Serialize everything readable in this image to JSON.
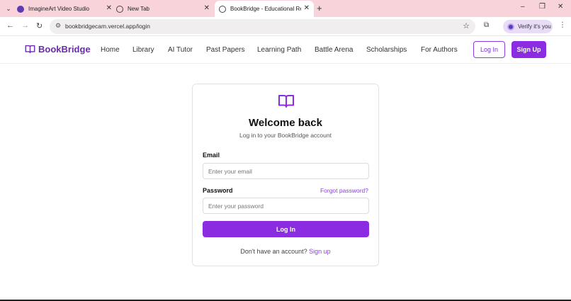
{
  "browser": {
    "tabs": [
      {
        "label": "ImagineArt Video Studio",
        "favicon_color": "#5b3bb6"
      },
      {
        "label": "New Tab",
        "favicon_color": "#444444"
      },
      {
        "label": "BookBridge - Educational Reso",
        "favicon_color": "#444444"
      }
    ],
    "new_tab_glyph": "+",
    "url": "bookbridgecam.vercel.app/login",
    "verify_label": "Verify it's you",
    "controls": {
      "minimize": "–",
      "restore": "❐",
      "close": "✕"
    }
  },
  "site": {
    "brand": "BookBridge",
    "nav": [
      "Home",
      "Library",
      "AI Tutor",
      "Past Papers",
      "Learning Path",
      "Battle Arena",
      "Scholarships",
      "For Authors"
    ],
    "login_label": "Log In",
    "signup_label": "Sign Up",
    "accent": "#8b2ce3"
  },
  "login": {
    "title": "Welcome back",
    "subtitle": "Log in to your BookBridge account",
    "email_label": "Email",
    "email_placeholder": "Enter your email",
    "password_label": "Password",
    "forgot_label": "Forgot password?",
    "password_placeholder": "Enter your password",
    "submit_label": "Log In",
    "no_account": "Don't have an account?",
    "signup_link": "Sign up"
  }
}
